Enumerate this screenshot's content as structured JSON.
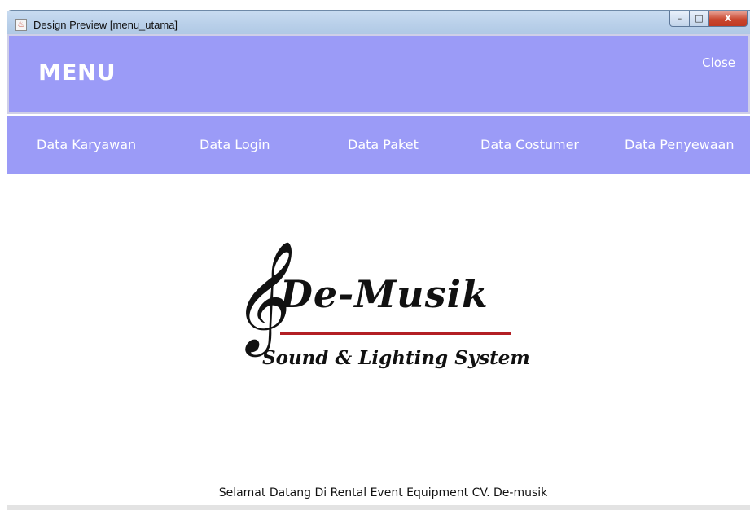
{
  "window": {
    "title": "Design Preview [menu_utama]",
    "controls": {
      "minimize": "–",
      "maximize": "□",
      "close": "X"
    }
  },
  "header": {
    "title": "MENU",
    "close_label": "Close",
    "color": "#9b9bf7"
  },
  "nav": {
    "items": [
      {
        "label": "Data Karyawan"
      },
      {
        "label": "Data Login"
      },
      {
        "label": "Data Paket"
      },
      {
        "label": "Data Costumer"
      },
      {
        "label": "Data Penyewaan"
      }
    ]
  },
  "logo": {
    "brand": "De-Musik",
    "tagline": "Sound & Lighting System",
    "clef_symbol": "𝄞",
    "underline_color": "#b31f24"
  },
  "footer": {
    "welcome": "Selamat Datang Di Rental Event Equipment CV. De-musik"
  }
}
